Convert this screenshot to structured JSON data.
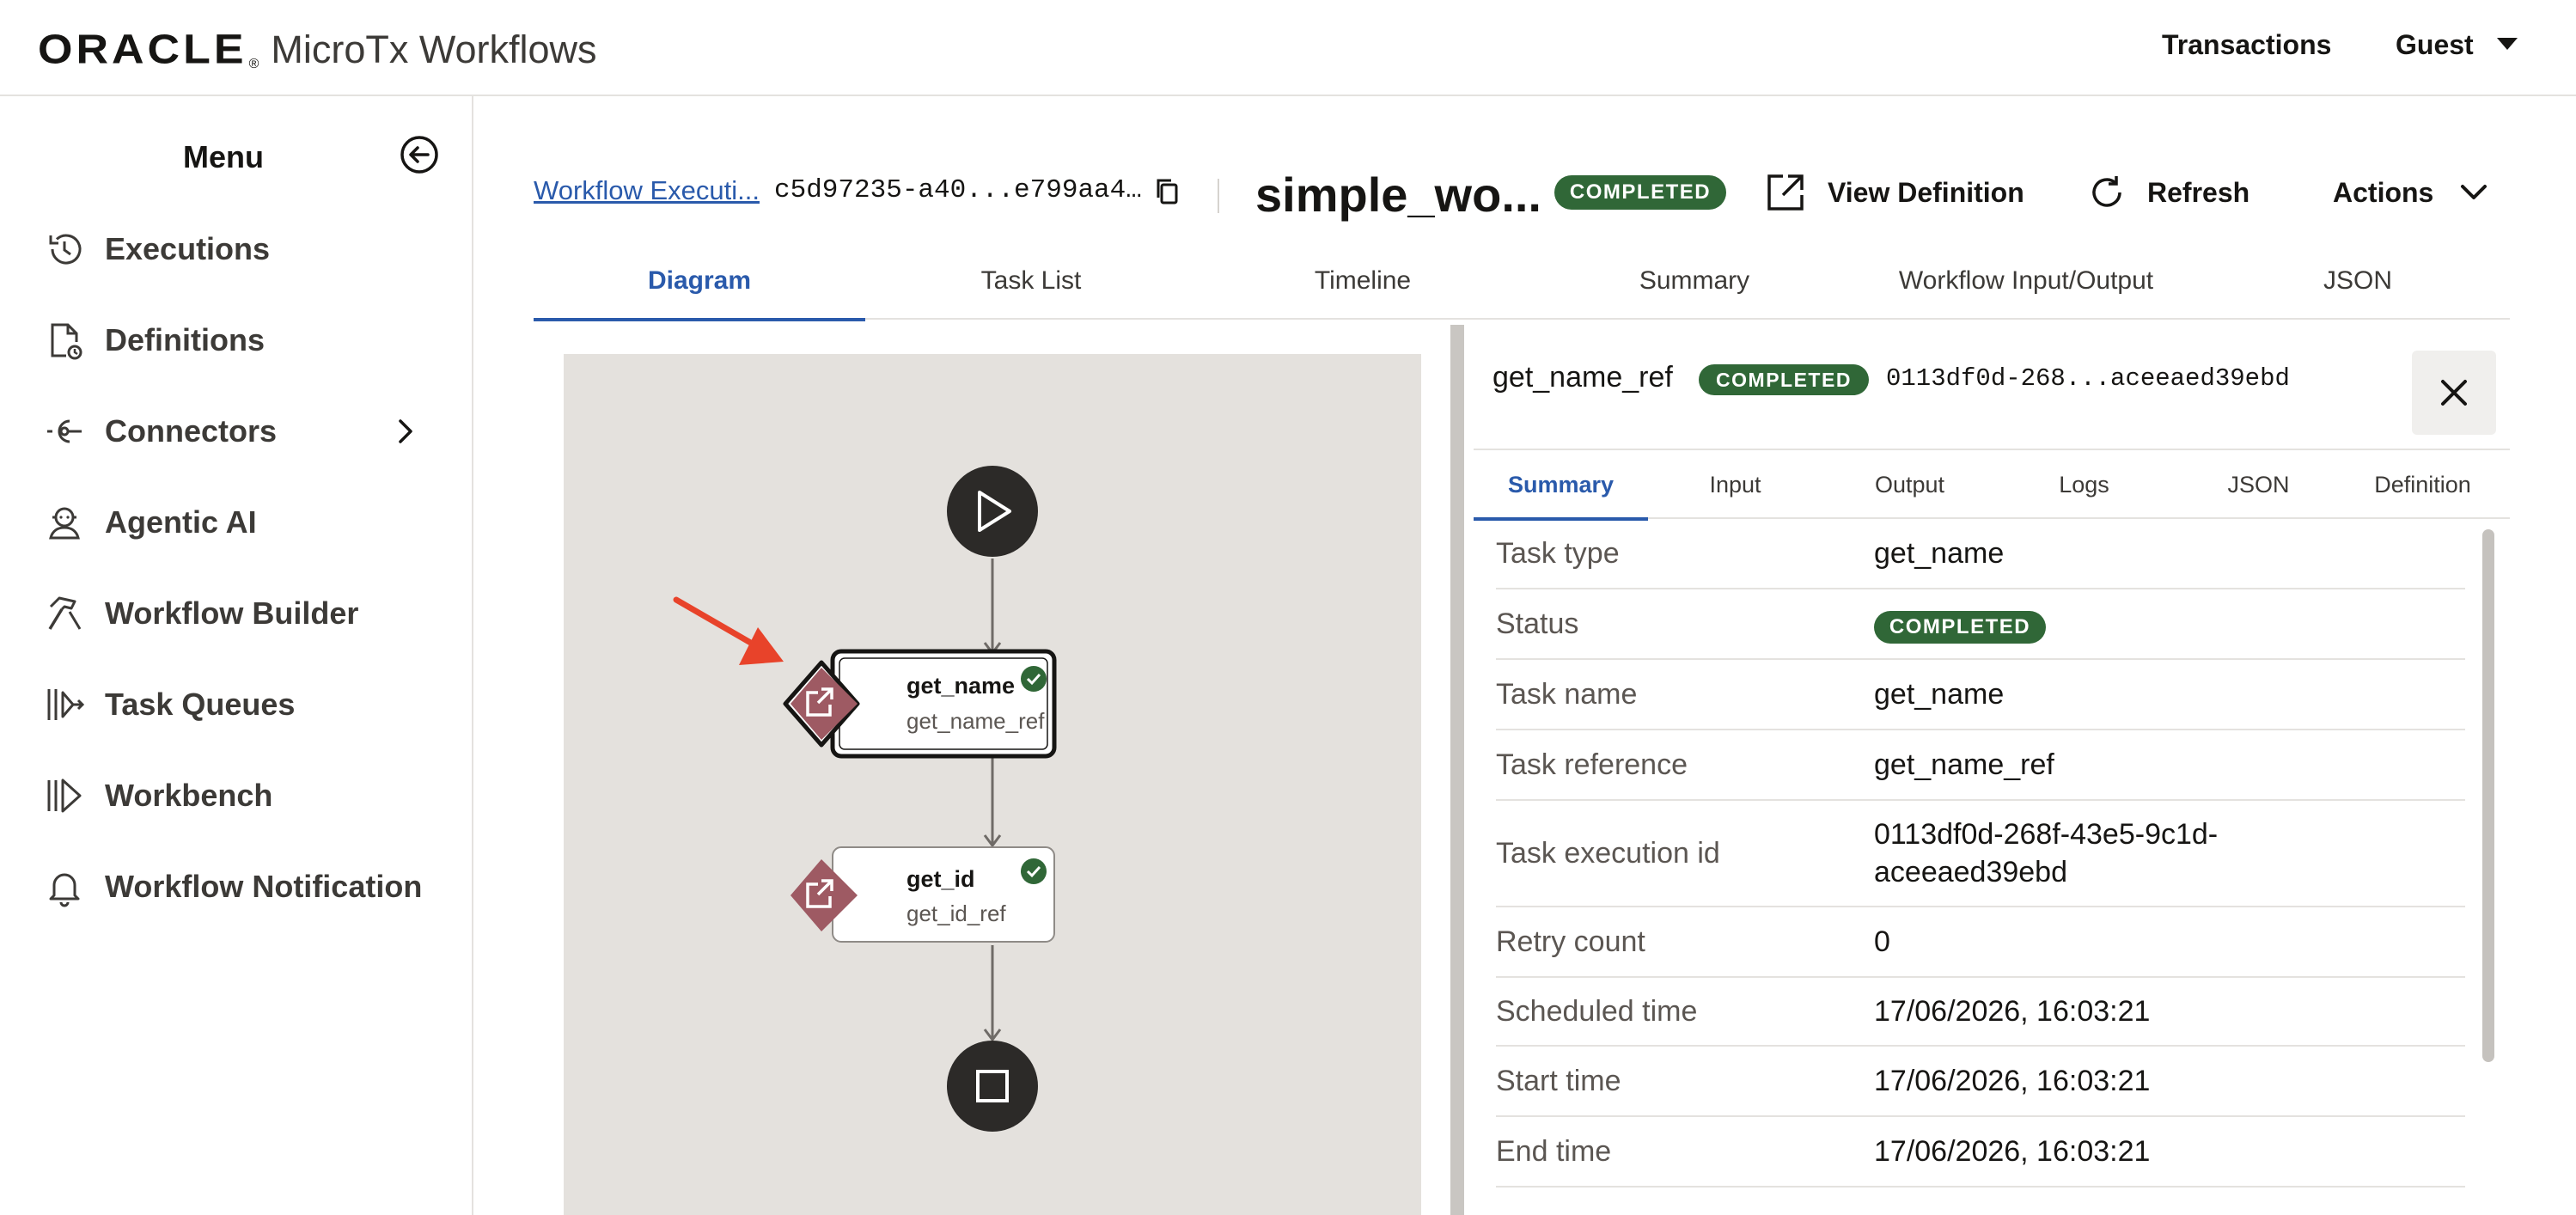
{
  "app": {
    "brand_oracle": "ORACLE",
    "brand_reg": "®",
    "brand_product": "MicroTx Workflows",
    "nav_transactions": "Transactions",
    "nav_user": "Guest"
  },
  "sidebar": {
    "title": "Menu",
    "items": [
      {
        "label": "Executions",
        "icon": "history-icon"
      },
      {
        "label": "Definitions",
        "icon": "document-clock-icon"
      },
      {
        "label": "Connectors",
        "icon": "connector-icon"
      },
      {
        "label": "Agentic AI",
        "icon": "agent-icon"
      },
      {
        "label": "Workflow Builder",
        "icon": "hammer-icon"
      },
      {
        "label": "Task Queues",
        "icon": "queue-icon"
      },
      {
        "label": "Workbench",
        "icon": "workbench-icon"
      },
      {
        "label": "Workflow Notification",
        "icon": "bell-icon"
      }
    ]
  },
  "header": {
    "breadcrumb_link": "Workflow Executi...",
    "execution_id": "c5d97235-a40...e799aa4…",
    "workflow_title": "simple_wo...",
    "status": "COMPLETED",
    "view_definition": "View Definition",
    "refresh": "Refresh",
    "actions": "Actions"
  },
  "tabs": [
    "Diagram",
    "Task List",
    "Timeline",
    "Summary",
    "Workflow Input/Output",
    "JSON"
  ],
  "active_tab": "Diagram",
  "diagram": {
    "nodes": [
      {
        "name": "get_name",
        "ref": "get_name_ref",
        "status": "completed",
        "selected": true
      },
      {
        "name": "get_id",
        "ref": "get_id_ref",
        "status": "completed",
        "selected": false
      }
    ]
  },
  "task_panel": {
    "task_ref": "get_name_ref",
    "status": "COMPLETED",
    "task_id": "0113df0d-268...aceeaed39ebd",
    "tabs": [
      "Summary",
      "Input",
      "Output",
      "Logs",
      "JSON",
      "Definition"
    ],
    "active_tab": "Summary",
    "rows": [
      {
        "label": "Task type",
        "value": "get_name"
      },
      {
        "label": "Status",
        "value": "COMPLETED",
        "badge": true
      },
      {
        "label": "Task name",
        "value": "get_name"
      },
      {
        "label": "Task reference",
        "value": "get_name_ref"
      },
      {
        "label": "Task execution id",
        "value": "0113df0d-268f-43e5-9c1d-aceeaed39ebd"
      },
      {
        "label": "Retry count",
        "value": "0"
      },
      {
        "label": "Scheduled time",
        "value": "17/06/2026, 16:03:21"
      },
      {
        "label": "Start time",
        "value": "17/06/2026, 16:03:21"
      },
      {
        "label": "End time",
        "value": "17/06/2026, 16:03:21"
      }
    ]
  },
  "colors": {
    "accent": "#2a5aab",
    "status_completed": "#306737",
    "task_node": "#9e5a63",
    "arrow_annotation": "#e8432a",
    "canvas_bg": "#e4e1dd"
  }
}
